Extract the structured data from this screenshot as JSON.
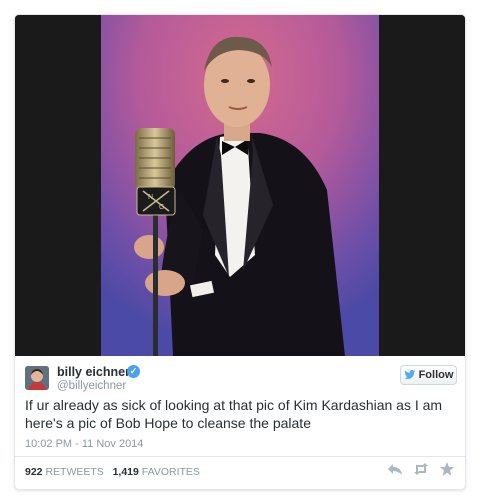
{
  "tweet": {
    "name": "billy eichner",
    "handle": "@billyeichner",
    "follow_label": "Follow",
    "text": "If ur already as sick of looking at that pic of Kim Kardashian as I am here's a pic of Bob Hope to cleanse the palate",
    "timestamp": "10:02 PM - 11 Nov 2014",
    "retweets_count": "922",
    "retweets_label": "RETWEETS",
    "favorites_count": "1,419",
    "favorites_label": "FAVORITES"
  },
  "icons": {
    "verified": "verified-badge-icon",
    "follow": "twitter-bird-icon",
    "reply": "reply-icon",
    "retweet": "retweet-icon",
    "favorite": "star-icon"
  },
  "colors": {
    "link_blue": "#4aa1ec",
    "text_dark": "#292f33",
    "text_muted": "#8899a6",
    "border": "#e1e8ed"
  }
}
